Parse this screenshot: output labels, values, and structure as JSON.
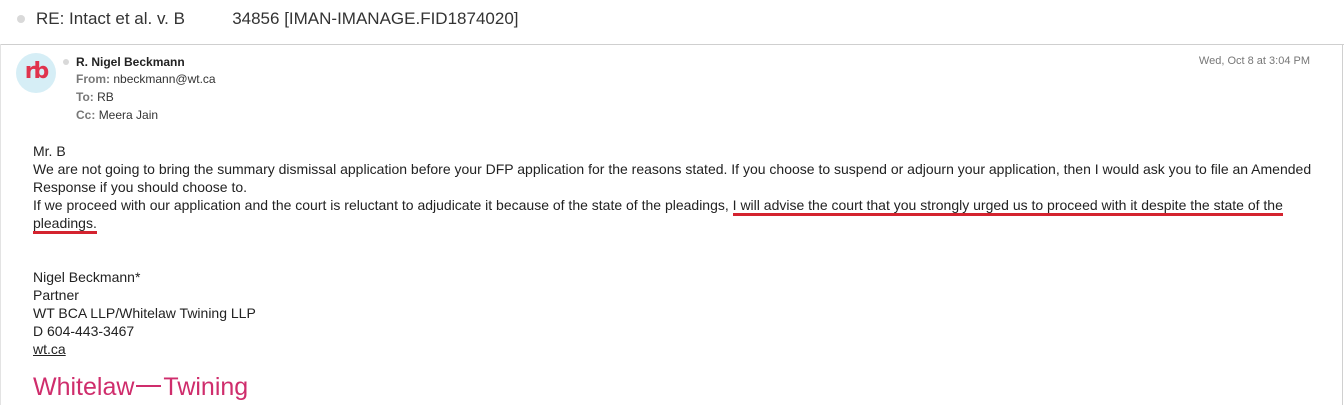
{
  "subject": {
    "text": "RE: Intact et al. v. B          34856 [IMAN-IMANAGE.FID1874020]"
  },
  "message": {
    "avatar_initials": "rb",
    "sender_name": "R. Nigel Beckmann",
    "from_label": "From:",
    "from_value": "nbeckmann@wt.ca",
    "to_label": "To:",
    "to_value": "RB",
    "cc_label": "Cc:",
    "cc_value": "Meera Jain",
    "date": "Wed, Oct 8 at 3:04 PM",
    "body": {
      "greeting": "Mr. B",
      "para1": "We are not going to bring the summary dismissal application before your DFP application for the reasons stated. If you choose to suspend or adjourn your application, then I would ask you to file an Amended Response if you should choose to.",
      "para2_plain": "If we proceed with our application and the court is reluctant to adjudicate it because of the state of the pleadings, ",
      "para2_highlight": "I will advise the court that you strongly urged us to proceed with it despite the state of the pleadings."
    },
    "signature": {
      "name": "Nigel Beckmann*",
      "title": "Partner",
      "firm": "WT BCA LLP/Whitelaw Twining LLP",
      "phone": "D 604-443-3467",
      "website": "wt.ca",
      "logo_left": "Whitelaw",
      "logo_right": "Twining"
    }
  },
  "colors": {
    "highlight_underline": "#d4232f",
    "logo": "#cf2d6c",
    "avatar_bg": "#d6eef6",
    "avatar_text": "#e0334d"
  }
}
